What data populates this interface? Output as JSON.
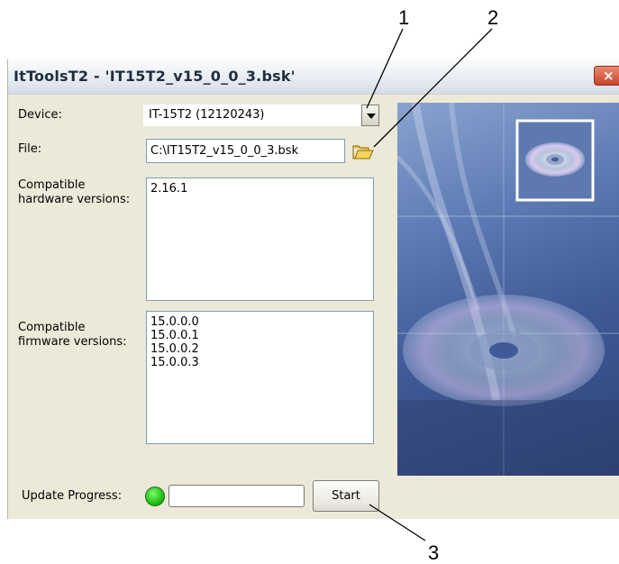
{
  "callouts": [
    "1",
    "2",
    "3"
  ],
  "window": {
    "title": "ItToolsT2 - 'IT15T2_v15_0_0_3.bsk'",
    "close_label": "×"
  },
  "form": {
    "device_label": "Device:",
    "device_value": "IT-15T2 (12120243)",
    "file_label": "File:",
    "file_value": "C:\\IT15T2_v15_0_0_3.bsk",
    "hw_label_1": "Compatible",
    "hw_label_2": "hardware versions:",
    "hw_versions": [
      "2.16.1"
    ],
    "fw_label_1": "Compatible",
    "fw_label_2": "firmware versions:",
    "fw_versions": [
      "15.0.0.0",
      "15.0.0.1",
      "15.0.0.2",
      "15.0.0.3"
    ],
    "progress_label": "Update Progress:",
    "progress_value": 0,
    "start_label": "Start"
  },
  "icons": {
    "dropdown": "chevron-down-icon",
    "browse": "folder-icon",
    "status": "status-led-icon",
    "close": "close-icon"
  },
  "colors": {
    "status_led": "#1fbf14",
    "close_button": "#c8452a",
    "picture_base": "#3f5a96"
  }
}
